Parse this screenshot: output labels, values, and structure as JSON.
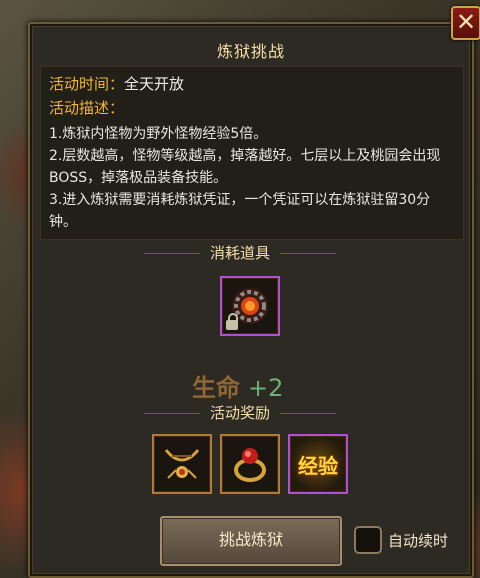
{
  "dialog": {
    "title": "炼狱挑战",
    "close_icon": "close-icon"
  },
  "info": {
    "time_label": "活动时间：",
    "time_value": "全天开放",
    "desc_label": "活动描述：",
    "lines": [
      "1.炼狱内怪物为野外怪物经验5倍。",
      "2.层数越高，怪物等级越高，掉落越好。七层以上及桃园会出现BOSS，掉落极品装备技能。",
      "3.进入炼狱需要消耗炼狱凭证，一个凭证可以在炼狱驻留30分钟。"
    ]
  },
  "cost": {
    "title": "消耗道具",
    "item_icon": "purgatory-token-icon",
    "locked": true
  },
  "floater": {
    "label": "生命",
    "value": "+2"
  },
  "rewards": {
    "title": "活动奖励",
    "items": [
      {
        "icon": "chain-necklace-icon",
        "border": "#b07a3a"
      },
      {
        "icon": "ruby-ring-icon",
        "border": "#b07a3a"
      },
      {
        "icon": "exp-icon",
        "text": "经验",
        "border": "#b24fd0"
      }
    ]
  },
  "actions": {
    "challenge_label": "挑战炼狱",
    "auto_label": "自动续时",
    "auto_checked": false
  }
}
